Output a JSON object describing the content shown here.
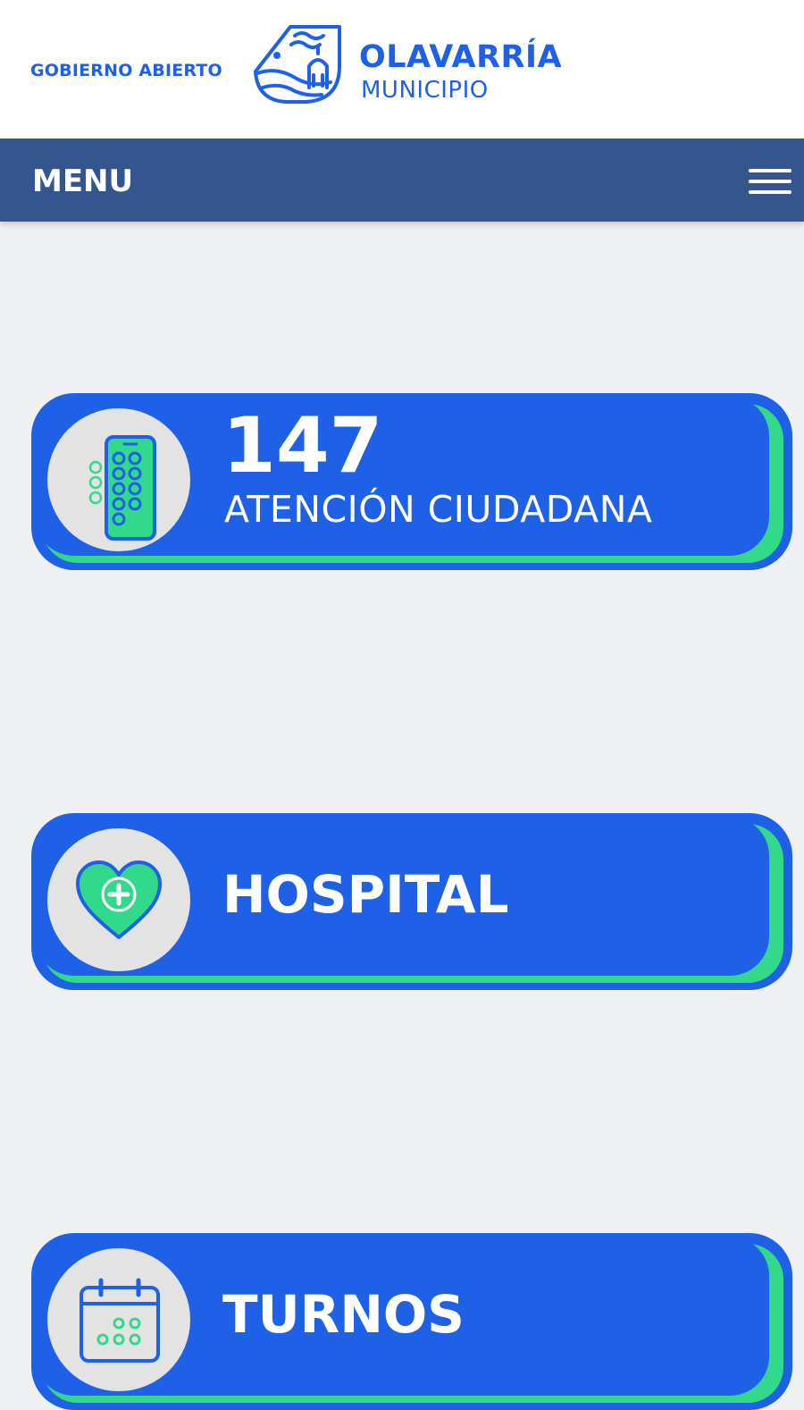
{
  "header": {
    "gobierno_abierto": "GOBIERNO ABIERTO",
    "logo_name": "OLAVARRÍA",
    "logo_sub": "MUNICIPIO"
  },
  "menu": {
    "label": "MENU"
  },
  "cards": [
    {
      "icon": "phone-keypad-icon",
      "number": "147",
      "label": "ATENCIÓN CIUDADANA"
    },
    {
      "icon": "heart-plus-icon",
      "label": "HOSPITAL"
    },
    {
      "icon": "calendar-icon",
      "label": "TURNOS"
    }
  ],
  "colors": {
    "brand_blue": "#1e60e6",
    "menu_bar": "#34558d",
    "accent_green": "#33d98a",
    "background": "#eef0f2"
  }
}
